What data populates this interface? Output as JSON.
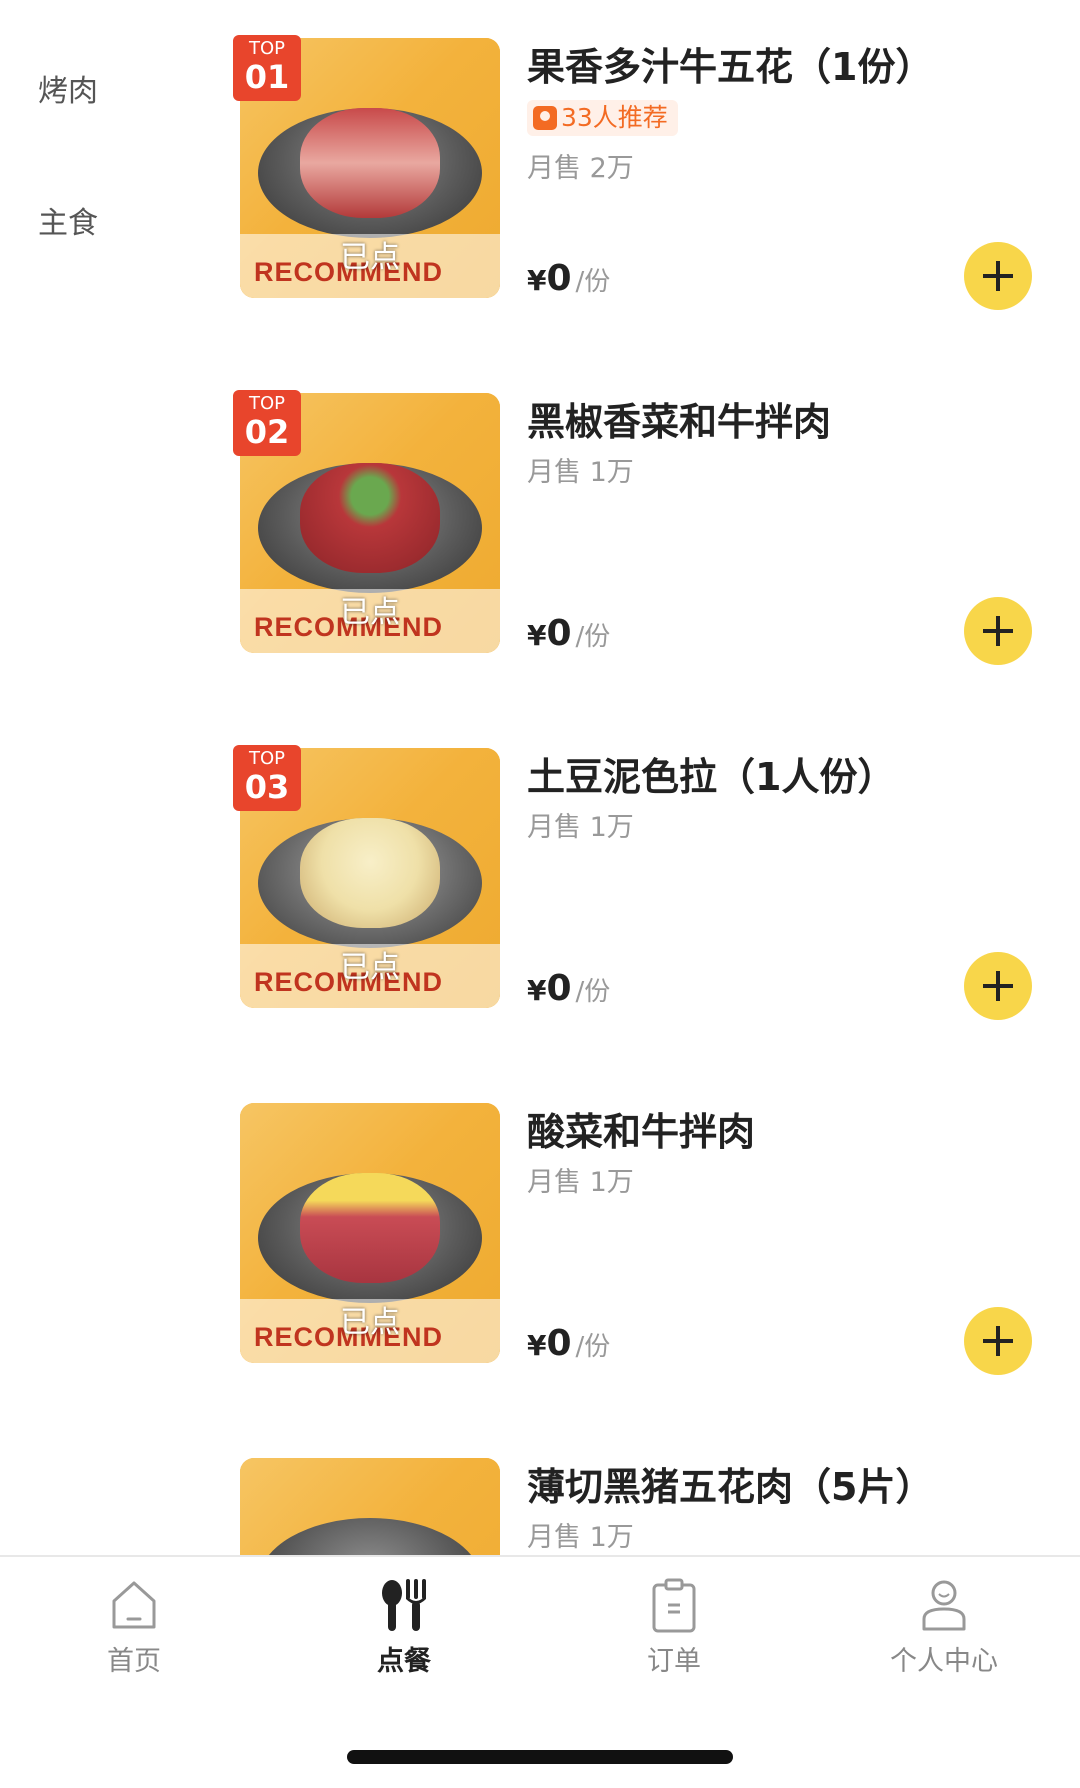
{
  "sidebar": {
    "categories": [
      {
        "label": "烤肉"
      },
      {
        "label": "主食"
      }
    ]
  },
  "items": [
    {
      "name": "果香多汁牛五花（1份）",
      "top_label": "TOP",
      "top_rank": "01",
      "recommend": "33人推荐",
      "sales": "月售 2万",
      "currency": "¥",
      "price": "0",
      "unit": "/份",
      "banner": "RECOMMEND",
      "ordered": "已点"
    },
    {
      "name": "黑椒香菜和牛拌肉",
      "top_label": "TOP",
      "top_rank": "02",
      "sales": "月售 1万",
      "currency": "¥",
      "price": "0",
      "unit": "/份",
      "banner": "RECOMMEND",
      "ordered": "已点"
    },
    {
      "name": "土豆泥色拉（1人份）",
      "top_label": "TOP",
      "top_rank": "03",
      "sales": "月售 1万",
      "currency": "¥",
      "price": "0",
      "unit": "/份",
      "banner": "RECOMMEND",
      "ordered": "已点"
    },
    {
      "name": "酸菜和牛拌肉",
      "sales": "月售 1万",
      "currency": "¥",
      "price": "0",
      "unit": "/份",
      "banner": "RECOMMEND",
      "ordered": "已点"
    },
    {
      "name": "薄切黑猪五花肉（5片）",
      "sales": "月售 1万"
    }
  ],
  "tabbar": {
    "tabs": [
      {
        "label": "首页",
        "icon": "home-icon"
      },
      {
        "label": "点餐",
        "icon": "utensils-icon"
      },
      {
        "label": "订单",
        "icon": "clipboard-icon"
      },
      {
        "label": "个人中心",
        "icon": "user-icon"
      }
    ]
  }
}
